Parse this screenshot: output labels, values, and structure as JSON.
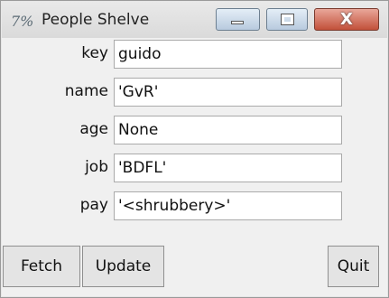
{
  "window": {
    "title": "People Shelve",
    "icon_text": "7%",
    "icons": [
      "minimize-icon",
      "maximize-icon",
      "close-icon"
    ],
    "close_glyph": "X"
  },
  "fields": [
    {
      "label": "key",
      "value": "guido"
    },
    {
      "label": "name",
      "value": "'GvR'"
    },
    {
      "label": "age",
      "value": "None"
    },
    {
      "label": "job",
      "value": "'BDFL'"
    },
    {
      "label": "pay",
      "value": "'<shrubbery>'"
    }
  ],
  "buttons": {
    "fetch": "Fetch",
    "update": "Update",
    "quit": "Quit"
  },
  "colors": {
    "close_button": "#c2503a",
    "window_chrome": "#b8cade"
  }
}
